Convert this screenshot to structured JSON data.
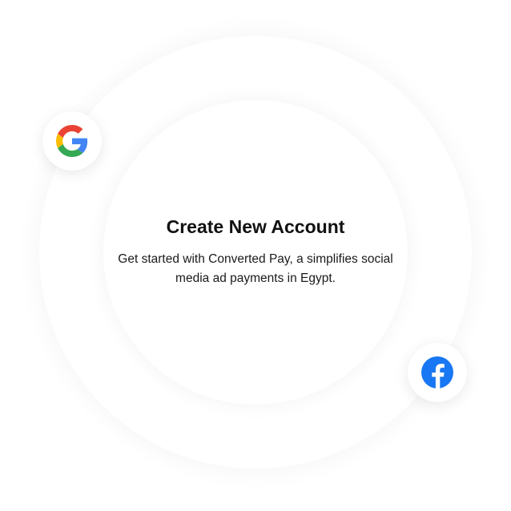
{
  "card": {
    "title": "Create New Account",
    "subtitle": "Get started with Converted Pay, a simplifies social media ad payments in Egypt."
  },
  "icons": {
    "google": "google-logo-icon",
    "facebook": "facebook-logo-icon"
  },
  "colors": {
    "facebook_blue": "#1877F2",
    "google_blue": "#4285F4",
    "google_red": "#EA4335",
    "google_yellow": "#FBBC05",
    "google_green": "#34A853",
    "title_text": "#111111"
  }
}
